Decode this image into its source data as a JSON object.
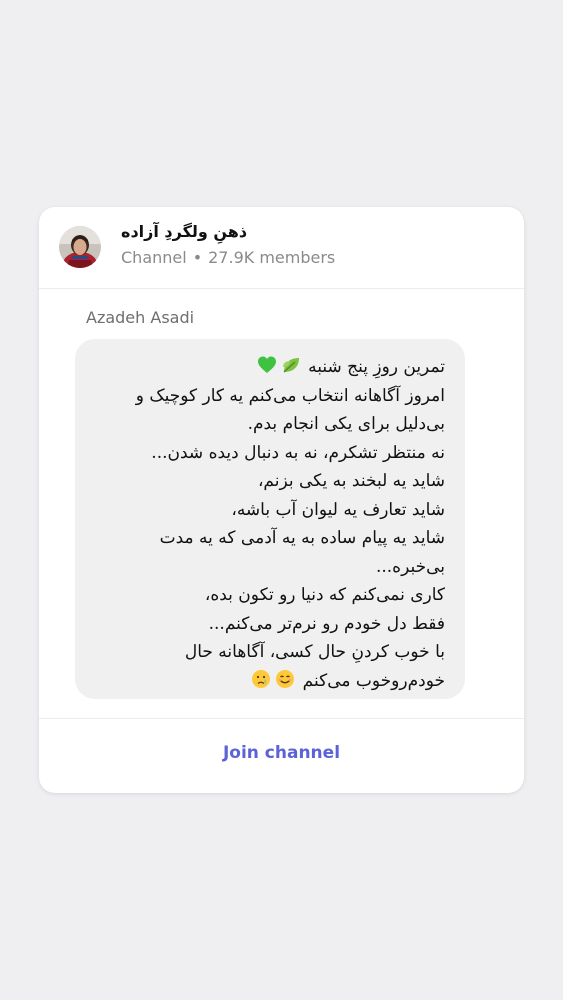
{
  "channel": {
    "title": "ذهنِ ولگردِ آزاده",
    "type_label": "Channel",
    "separator": "•",
    "members": "27.9K members",
    "avatar_icon": "avatar-photo"
  },
  "message": {
    "sender": "Azadeh Asadi",
    "line1": "تمرین روزِ پنج شنبه",
    "body": "امروز آگاهانه انتخاب می‌کنم یه کار کوچیک و\nبی‌دلیل برای یکی انجام بدم.\nنه منتظر تشکرم، نه به دنبال دیده شدن...\nشاید یه لبخند به یکی بزنم،\nشاید تعارف یه لیوان آب باشه،\nشاید یه پیام ساده به یه آدمی که یه مدت\nبی‌خبره...\nکاری نمی‌کنم که دنیا رو تکون بده،\nفقط دل خودم رو نرم‌تر می‌کنم...\nبا خوب کردنِ حال کسی، آگاهانه حال",
    "last_line": "خودم‌روخوب می‌کنم",
    "line1_icons": [
      "leaf-icon",
      "green-heart-icon"
    ],
    "last_line_icons": [
      "smile-icon",
      "crying-icon"
    ]
  },
  "footer": {
    "join_label": "Join channel",
    "accent": "#5b63d6"
  },
  "colors": {
    "page_bg": "#efeff1",
    "bubble_bg": "#f0f0f1",
    "muted": "#8a8a8e"
  }
}
